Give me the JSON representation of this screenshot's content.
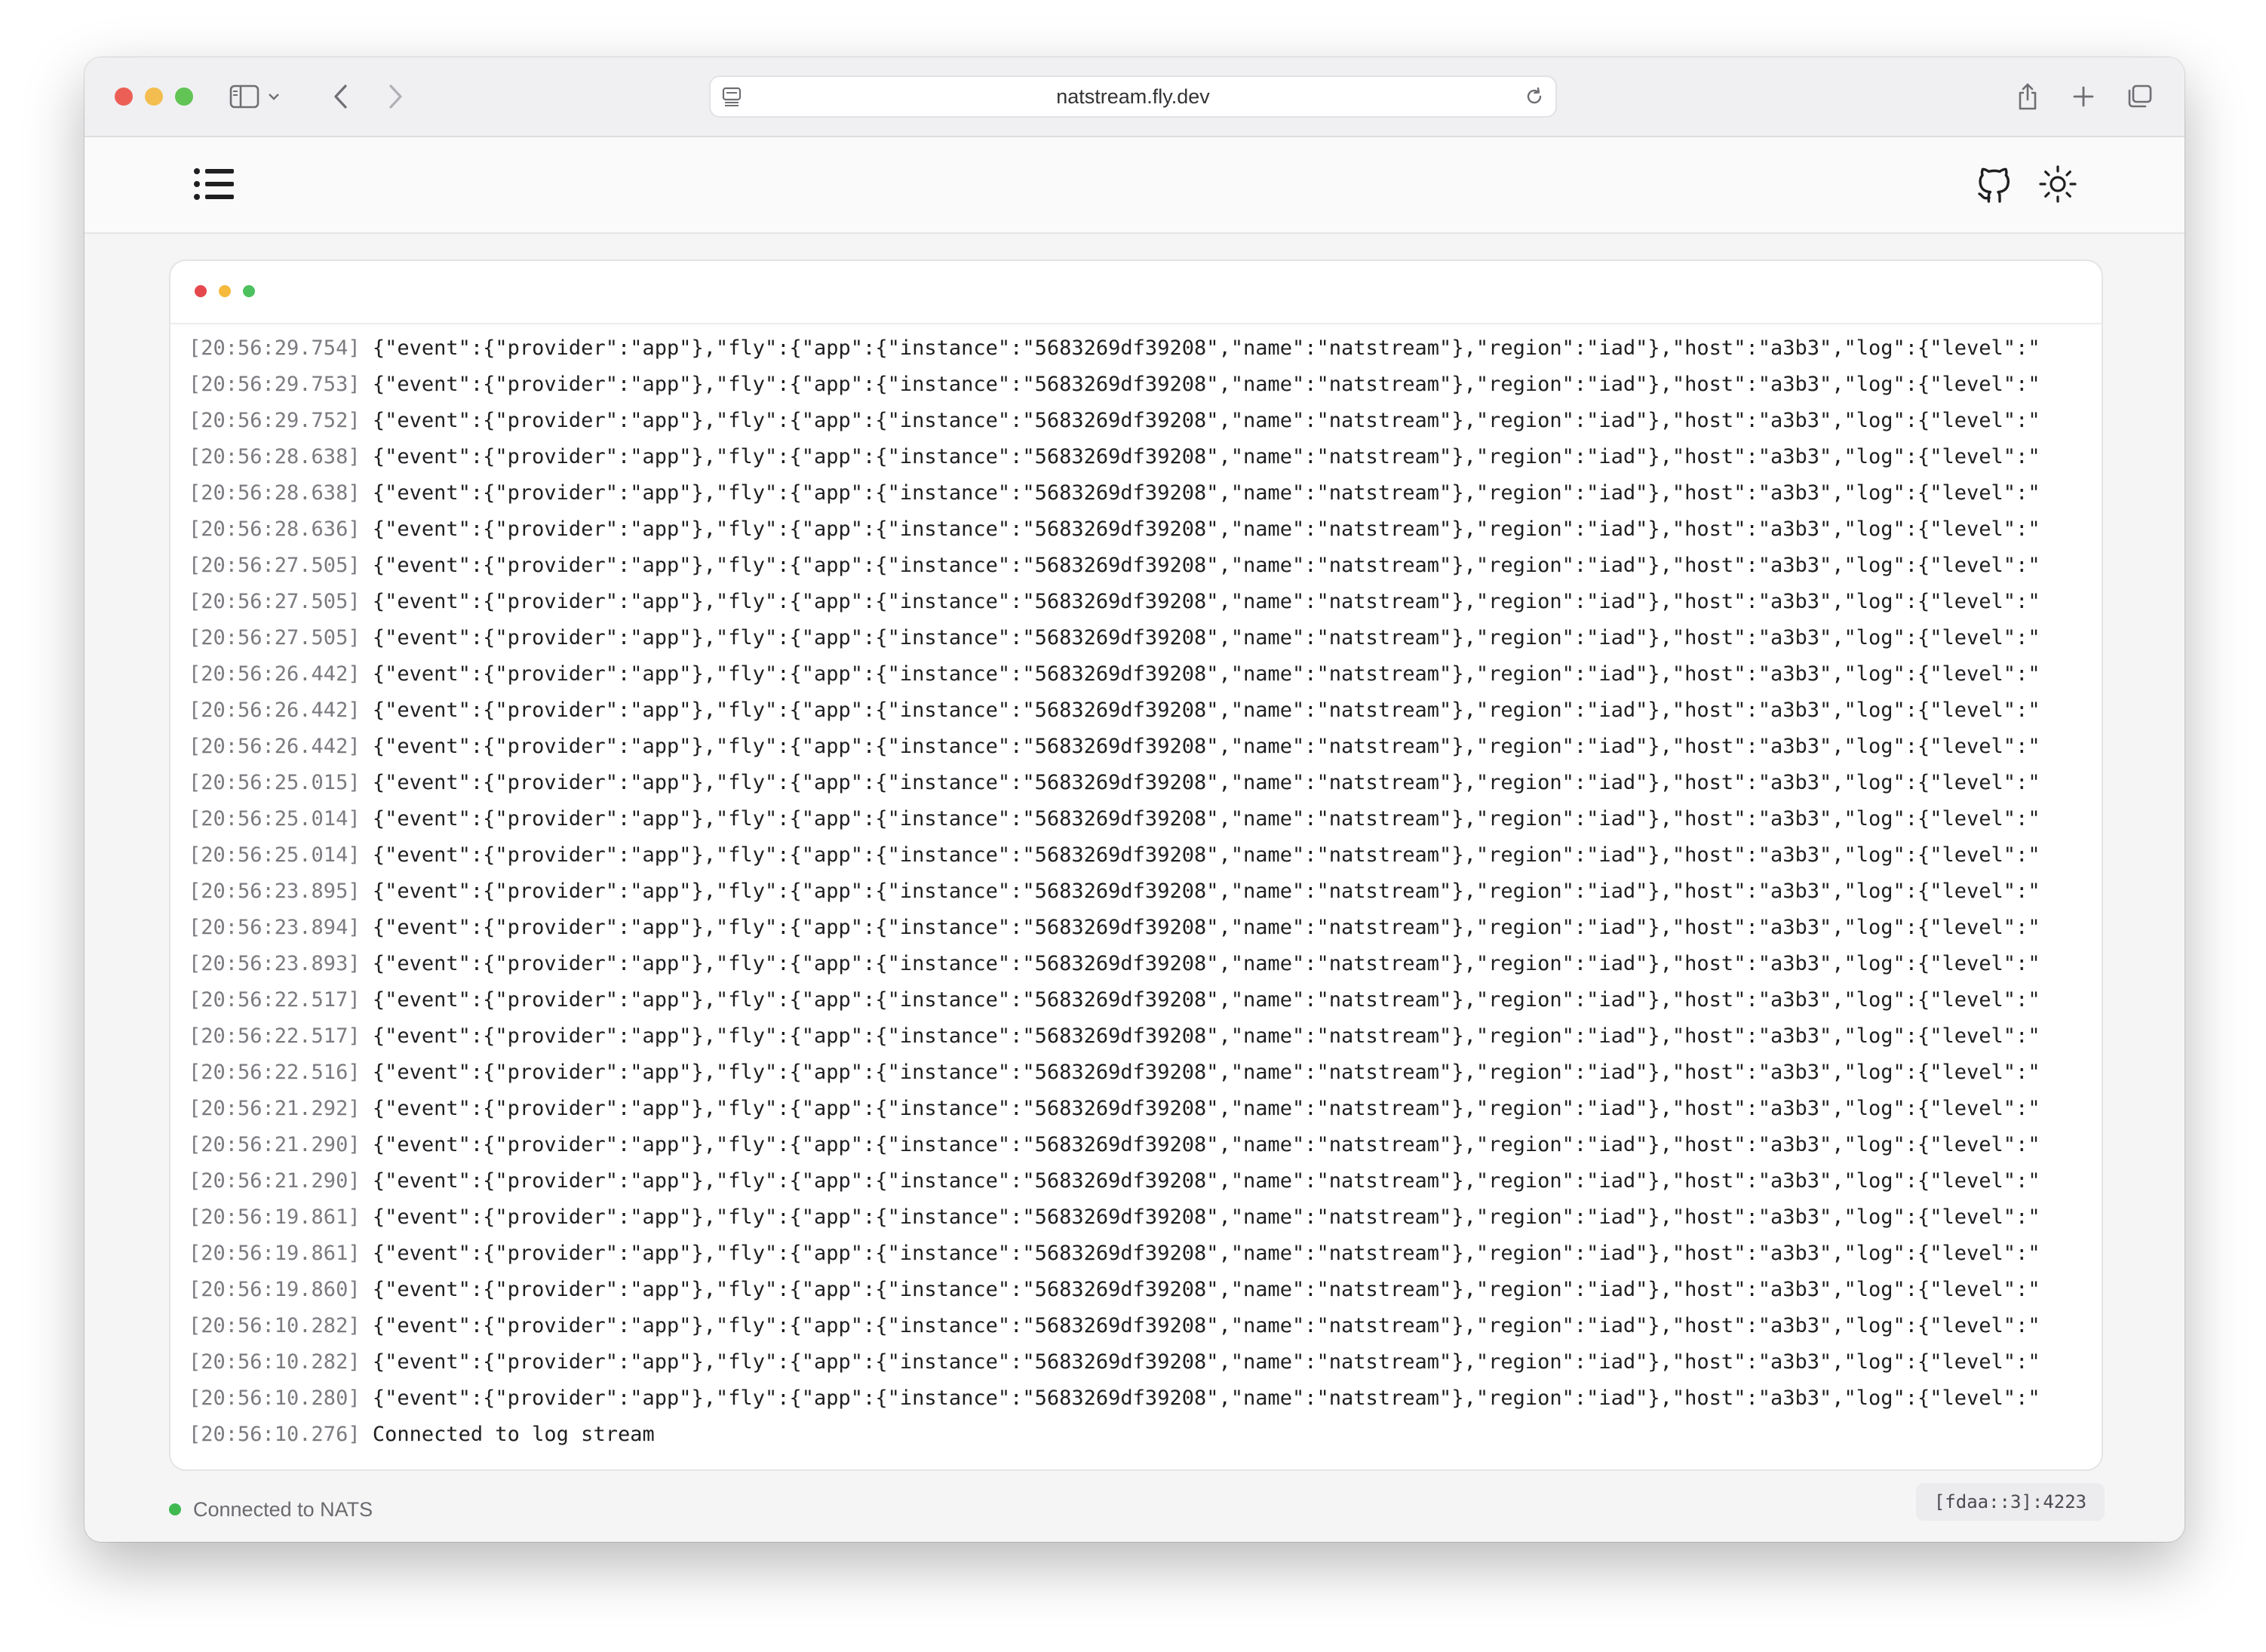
{
  "browser": {
    "url": "natstream.fly.dev"
  },
  "log": {
    "entries": [
      {
        "ts": "[20:56:29.754]",
        "msg": "{\"event\":{\"provider\":\"app\"},\"fly\":{\"app\":{\"instance\":\"5683269df39208\",\"name\":\"natstream\"},\"region\":\"iad\"},\"host\":\"a3b3\",\"log\":{\"level\":\""
      },
      {
        "ts": "[20:56:29.753]",
        "msg": "{\"event\":{\"provider\":\"app\"},\"fly\":{\"app\":{\"instance\":\"5683269df39208\",\"name\":\"natstream\"},\"region\":\"iad\"},\"host\":\"a3b3\",\"log\":{\"level\":\""
      },
      {
        "ts": "[20:56:29.752]",
        "msg": "{\"event\":{\"provider\":\"app\"},\"fly\":{\"app\":{\"instance\":\"5683269df39208\",\"name\":\"natstream\"},\"region\":\"iad\"},\"host\":\"a3b3\",\"log\":{\"level\":\""
      },
      {
        "ts": "[20:56:28.638]",
        "msg": "{\"event\":{\"provider\":\"app\"},\"fly\":{\"app\":{\"instance\":\"5683269df39208\",\"name\":\"natstream\"},\"region\":\"iad\"},\"host\":\"a3b3\",\"log\":{\"level\":\""
      },
      {
        "ts": "[20:56:28.638]",
        "msg": "{\"event\":{\"provider\":\"app\"},\"fly\":{\"app\":{\"instance\":\"5683269df39208\",\"name\":\"natstream\"},\"region\":\"iad\"},\"host\":\"a3b3\",\"log\":{\"level\":\""
      },
      {
        "ts": "[20:56:28.636]",
        "msg": "{\"event\":{\"provider\":\"app\"},\"fly\":{\"app\":{\"instance\":\"5683269df39208\",\"name\":\"natstream\"},\"region\":\"iad\"},\"host\":\"a3b3\",\"log\":{\"level\":\""
      },
      {
        "ts": "[20:56:27.505]",
        "msg": "{\"event\":{\"provider\":\"app\"},\"fly\":{\"app\":{\"instance\":\"5683269df39208\",\"name\":\"natstream\"},\"region\":\"iad\"},\"host\":\"a3b3\",\"log\":{\"level\":\""
      },
      {
        "ts": "[20:56:27.505]",
        "msg": "{\"event\":{\"provider\":\"app\"},\"fly\":{\"app\":{\"instance\":\"5683269df39208\",\"name\":\"natstream\"},\"region\":\"iad\"},\"host\":\"a3b3\",\"log\":{\"level\":\""
      },
      {
        "ts": "[20:56:27.505]",
        "msg": "{\"event\":{\"provider\":\"app\"},\"fly\":{\"app\":{\"instance\":\"5683269df39208\",\"name\":\"natstream\"},\"region\":\"iad\"},\"host\":\"a3b3\",\"log\":{\"level\":\""
      },
      {
        "ts": "[20:56:26.442]",
        "msg": "{\"event\":{\"provider\":\"app\"},\"fly\":{\"app\":{\"instance\":\"5683269df39208\",\"name\":\"natstream\"},\"region\":\"iad\"},\"host\":\"a3b3\",\"log\":{\"level\":\""
      },
      {
        "ts": "[20:56:26.442]",
        "msg": "{\"event\":{\"provider\":\"app\"},\"fly\":{\"app\":{\"instance\":\"5683269df39208\",\"name\":\"natstream\"},\"region\":\"iad\"},\"host\":\"a3b3\",\"log\":{\"level\":\""
      },
      {
        "ts": "[20:56:26.442]",
        "msg": "{\"event\":{\"provider\":\"app\"},\"fly\":{\"app\":{\"instance\":\"5683269df39208\",\"name\":\"natstream\"},\"region\":\"iad\"},\"host\":\"a3b3\",\"log\":{\"level\":\""
      },
      {
        "ts": "[20:56:25.015]",
        "msg": "{\"event\":{\"provider\":\"app\"},\"fly\":{\"app\":{\"instance\":\"5683269df39208\",\"name\":\"natstream\"},\"region\":\"iad\"},\"host\":\"a3b3\",\"log\":{\"level\":\""
      },
      {
        "ts": "[20:56:25.014]",
        "msg": "{\"event\":{\"provider\":\"app\"},\"fly\":{\"app\":{\"instance\":\"5683269df39208\",\"name\":\"natstream\"},\"region\":\"iad\"},\"host\":\"a3b3\",\"log\":{\"level\":\""
      },
      {
        "ts": "[20:56:25.014]",
        "msg": "{\"event\":{\"provider\":\"app\"},\"fly\":{\"app\":{\"instance\":\"5683269df39208\",\"name\":\"natstream\"},\"region\":\"iad\"},\"host\":\"a3b3\",\"log\":{\"level\":\""
      },
      {
        "ts": "[20:56:23.895]",
        "msg": "{\"event\":{\"provider\":\"app\"},\"fly\":{\"app\":{\"instance\":\"5683269df39208\",\"name\":\"natstream\"},\"region\":\"iad\"},\"host\":\"a3b3\",\"log\":{\"level\":\""
      },
      {
        "ts": "[20:56:23.894]",
        "msg": "{\"event\":{\"provider\":\"app\"},\"fly\":{\"app\":{\"instance\":\"5683269df39208\",\"name\":\"natstream\"},\"region\":\"iad\"},\"host\":\"a3b3\",\"log\":{\"level\":\""
      },
      {
        "ts": "[20:56:23.893]",
        "msg": "{\"event\":{\"provider\":\"app\"},\"fly\":{\"app\":{\"instance\":\"5683269df39208\",\"name\":\"natstream\"},\"region\":\"iad\"},\"host\":\"a3b3\",\"log\":{\"level\":\""
      },
      {
        "ts": "[20:56:22.517]",
        "msg": "{\"event\":{\"provider\":\"app\"},\"fly\":{\"app\":{\"instance\":\"5683269df39208\",\"name\":\"natstream\"},\"region\":\"iad\"},\"host\":\"a3b3\",\"log\":{\"level\":\""
      },
      {
        "ts": "[20:56:22.517]",
        "msg": "{\"event\":{\"provider\":\"app\"},\"fly\":{\"app\":{\"instance\":\"5683269df39208\",\"name\":\"natstream\"},\"region\":\"iad\"},\"host\":\"a3b3\",\"log\":{\"level\":\""
      },
      {
        "ts": "[20:56:22.516]",
        "msg": "{\"event\":{\"provider\":\"app\"},\"fly\":{\"app\":{\"instance\":\"5683269df39208\",\"name\":\"natstream\"},\"region\":\"iad\"},\"host\":\"a3b3\",\"log\":{\"level\":\""
      },
      {
        "ts": "[20:56:21.292]",
        "msg": "{\"event\":{\"provider\":\"app\"},\"fly\":{\"app\":{\"instance\":\"5683269df39208\",\"name\":\"natstream\"},\"region\":\"iad\"},\"host\":\"a3b3\",\"log\":{\"level\":\""
      },
      {
        "ts": "[20:56:21.290]",
        "msg": "{\"event\":{\"provider\":\"app\"},\"fly\":{\"app\":{\"instance\":\"5683269df39208\",\"name\":\"natstream\"},\"region\":\"iad\"},\"host\":\"a3b3\",\"log\":{\"level\":\""
      },
      {
        "ts": "[20:56:21.290]",
        "msg": "{\"event\":{\"provider\":\"app\"},\"fly\":{\"app\":{\"instance\":\"5683269df39208\",\"name\":\"natstream\"},\"region\":\"iad\"},\"host\":\"a3b3\",\"log\":{\"level\":\""
      },
      {
        "ts": "[20:56:19.861]",
        "msg": "{\"event\":{\"provider\":\"app\"},\"fly\":{\"app\":{\"instance\":\"5683269df39208\",\"name\":\"natstream\"},\"region\":\"iad\"},\"host\":\"a3b3\",\"log\":{\"level\":\""
      },
      {
        "ts": "[20:56:19.861]",
        "msg": "{\"event\":{\"provider\":\"app\"},\"fly\":{\"app\":{\"instance\":\"5683269df39208\",\"name\":\"natstream\"},\"region\":\"iad\"},\"host\":\"a3b3\",\"log\":{\"level\":\""
      },
      {
        "ts": "[20:56:19.860]",
        "msg": "{\"event\":{\"provider\":\"app\"},\"fly\":{\"app\":{\"instance\":\"5683269df39208\",\"name\":\"natstream\"},\"region\":\"iad\"},\"host\":\"a3b3\",\"log\":{\"level\":\""
      },
      {
        "ts": "[20:56:10.282]",
        "msg": "{\"event\":{\"provider\":\"app\"},\"fly\":{\"app\":{\"instance\":\"5683269df39208\",\"name\":\"natstream\"},\"region\":\"iad\"},\"host\":\"a3b3\",\"log\":{\"level\":\""
      },
      {
        "ts": "[20:56:10.282]",
        "msg": "{\"event\":{\"provider\":\"app\"},\"fly\":{\"app\":{\"instance\":\"5683269df39208\",\"name\":\"natstream\"},\"region\":\"iad\"},\"host\":\"a3b3\",\"log\":{\"level\":\""
      },
      {
        "ts": "[20:56:10.280]",
        "msg": "{\"event\":{\"provider\":\"app\"},\"fly\":{\"app\":{\"instance\":\"5683269df39208\",\"name\":\"natstream\"},\"region\":\"iad\"},\"host\":\"a3b3\",\"log\":{\"level\":\""
      },
      {
        "ts": "[20:56:10.276]",
        "msg": "Connected to log stream"
      }
    ]
  },
  "footer": {
    "status_text": "Connected to NATS",
    "status_color": "#3fb950",
    "server_address": "[fdaa::3]:4223"
  },
  "icons": {
    "sidebar": "sidebar-icon",
    "chevron": "chevron-down-icon",
    "back": "back-arrow-icon",
    "forward": "forward-arrow-icon",
    "share": "share-icon",
    "new_tab": "plus-icon",
    "tabs": "tabs-overview-icon",
    "menu": "menu-list-icon",
    "github": "github-icon",
    "theme": "sun-icon"
  }
}
